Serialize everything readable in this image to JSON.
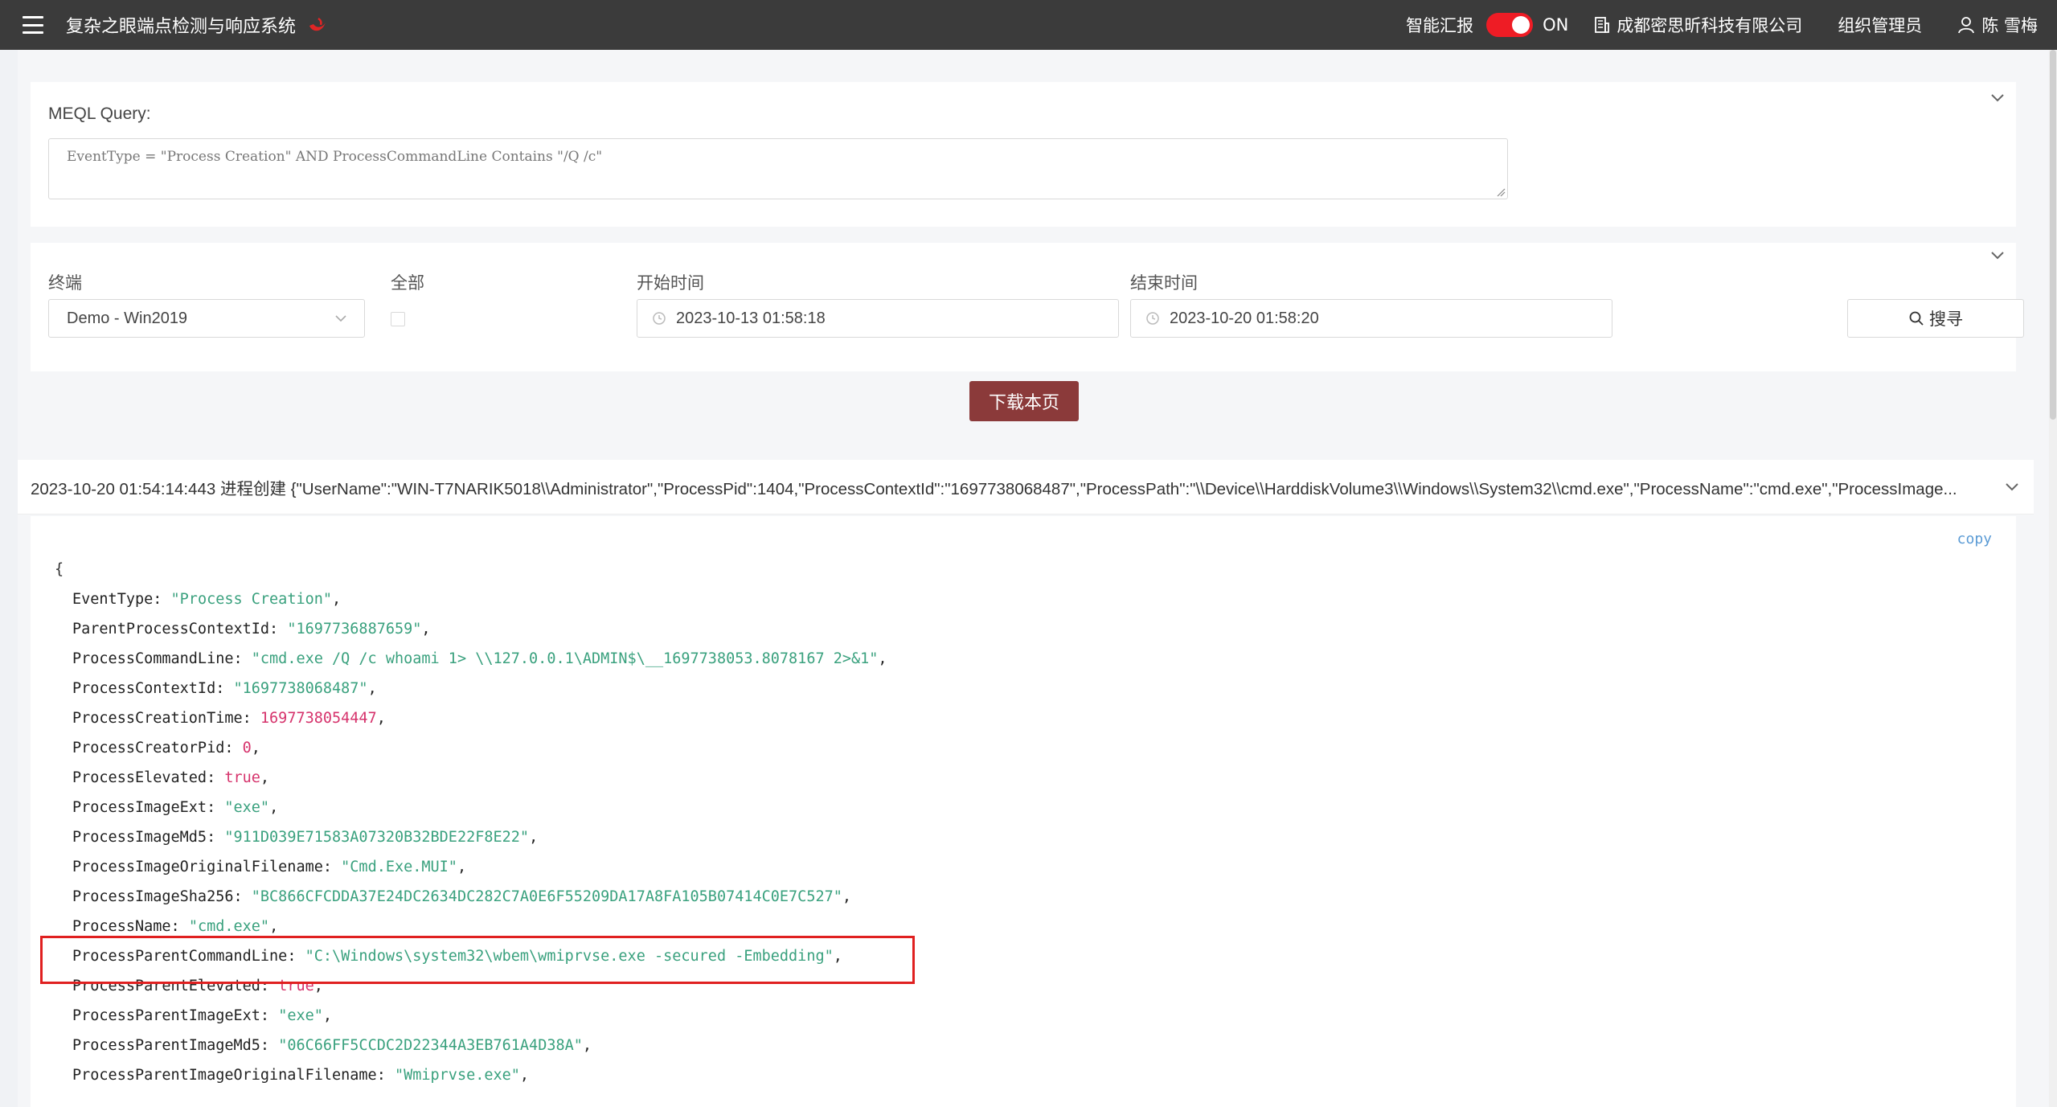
{
  "header": {
    "app_title": "复杂之眼端点检测与响应系统",
    "smart_report_label": "智能汇报",
    "toggle_state": "ON",
    "company": "成都密思昕科技有限公司",
    "role": "组织管理员",
    "user": "陈 雪梅",
    "toggle_color": "#ee1c25",
    "bar_color": "#3b3b3b"
  },
  "query": {
    "label": "MEQL Query:",
    "value": "EventType = \"Process Creation\" AND ProcessCommandLine Contains \"/Q /c\""
  },
  "filters": {
    "terminal_label": "终端",
    "terminal_value": "Demo - Win2019",
    "all_label": "全部",
    "start_label": "开始时间",
    "start_value": "2023-10-13 01:58:18",
    "end_label": "结束时间",
    "end_value": "2023-10-20 01:58:20",
    "search_label": "搜寻"
  },
  "download_label": "下载本页",
  "event_summary": "2023-10-20 01:54:14:443 进程创建 {\"UserName\":\"WIN-T7NARIK5018\\\\Administrator\",\"ProcessPid\":1404,\"ProcessContextId\":\"1697738068487\",\"ProcessPath\":\"\\\\Device\\\\HarddiskVolume3\\\\Windows\\\\System32\\\\cmd.exe\",\"ProcessName\":\"cmd.exe\",\"ProcessImage...",
  "copy_label": "copy",
  "json_lines": [
    {
      "key": "EventType",
      "value": "\"Process Creation\"",
      "type": "str"
    },
    {
      "key": "ParentProcessContextId",
      "value": "\"1697736887659\"",
      "type": "str"
    },
    {
      "key": "ProcessCommandLine",
      "value": "\"cmd.exe /Q /c whoami 1> \\\\127.0.0.1\\ADMIN$\\__1697738053.8078167 2>&1\"",
      "type": "str"
    },
    {
      "key": "ProcessContextId",
      "value": "\"1697738068487\"",
      "type": "str"
    },
    {
      "key": "ProcessCreationTime",
      "value": "1697738054447",
      "type": "num"
    },
    {
      "key": "ProcessCreatorPid",
      "value": "0",
      "type": "num"
    },
    {
      "key": "ProcessElevated",
      "value": "true",
      "type": "bool"
    },
    {
      "key": "ProcessImageExt",
      "value": "\"exe\"",
      "type": "str"
    },
    {
      "key": "ProcessImageMd5",
      "value": "\"911D039E71583A07320B32BDE22F8E22\"",
      "type": "str"
    },
    {
      "key": "ProcessImageOriginalFilename",
      "value": "\"Cmd.Exe.MUI\"",
      "type": "str"
    },
    {
      "key": "ProcessImageSha256",
      "value": "\"BC866CFCDDA37E24DC2634DC282C7A0E6F55209DA17A8FA105B07414C0E7C527\"",
      "type": "str"
    },
    {
      "key": "ProcessName",
      "value": "\"cmd.exe\"",
      "type": "str"
    },
    {
      "key": "ProcessParentCommandLine",
      "value": "\"C:\\Windows\\system32\\wbem\\wmiprvse.exe -secured -Embedding\"",
      "type": "str"
    },
    {
      "key": "ProcessParentElevated",
      "value": "true",
      "type": "bool"
    },
    {
      "key": "ProcessParentImageExt",
      "value": "\"exe\"",
      "type": "str"
    },
    {
      "key": "ProcessParentImageMd5",
      "value": "\"06C66FF5CCDC2D22344A3EB761A4D38A\"",
      "type": "str"
    },
    {
      "key": "ProcessParentImageOriginalFilename",
      "value": "\"Wmiprvse.exe\"",
      "type": "str"
    }
  ],
  "open_brace": "{"
}
